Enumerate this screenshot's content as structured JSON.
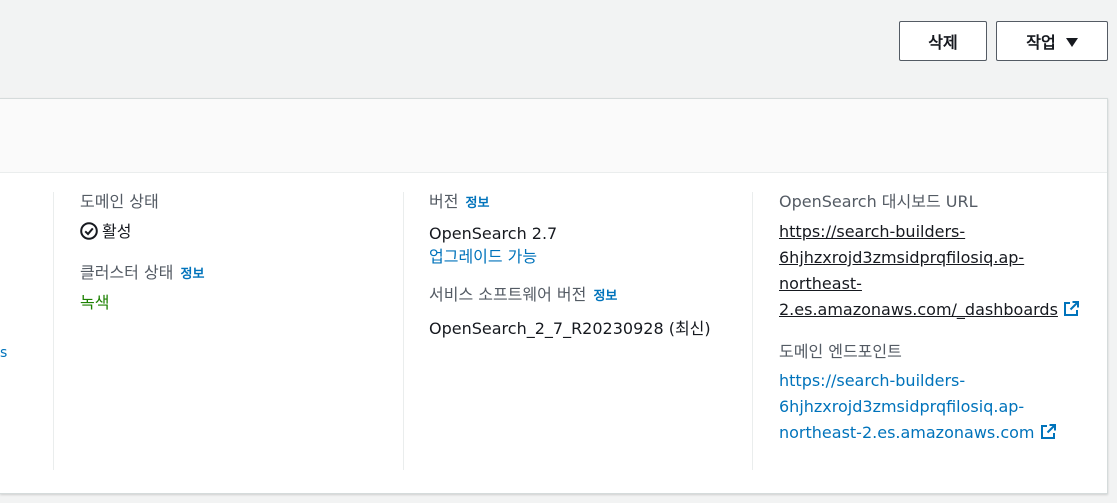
{
  "actions": {
    "delete_label": "삭제",
    "actions_label": "작업"
  },
  "domain_status": {
    "label": "도메인 상태",
    "value": "활성"
  },
  "cluster_status": {
    "label": "클러스터 상태",
    "info": "정보",
    "value": "녹색"
  },
  "version": {
    "label": "버전",
    "info": "정보",
    "value": "OpenSearch 2.7",
    "upgrade_link": "업그레이드 가능"
  },
  "service_software": {
    "label": "서비스 소프트웨어 버전",
    "info": "정보",
    "value": "OpenSearch_2_7_R20230928 (최신)"
  },
  "dashboards_url": {
    "label": "OpenSearch 대시보드 URL",
    "lines": [
      "https://search-builders-",
      "6hjhzxrojd3zmsidprqfilosiq.ap-",
      "northeast-",
      "2.es.amazonaws.com/_dashboards"
    ]
  },
  "domain_endpoint": {
    "label": "도메인 엔드포인트",
    "lines": [
      "https://search-builders-",
      "6hjhzxrojd3zmsidprqfilosiq.ap-",
      "northeast-2.es.amazonaws.com"
    ]
  },
  "left_fragment": "s",
  "colors": {
    "link": "#0073bb",
    "success": "#1d8102",
    "text": "#16191f",
    "muted": "#545b64"
  }
}
